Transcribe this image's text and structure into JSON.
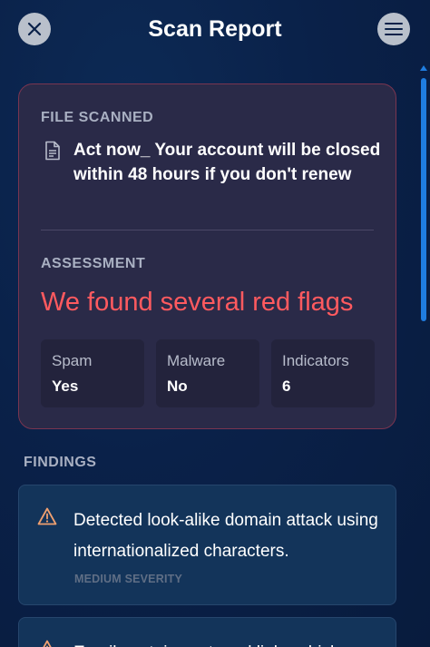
{
  "header": {
    "title": "Scan Report",
    "close_icon": "close-icon",
    "menu_icon": "menu-icon"
  },
  "report": {
    "file_section_label": "FILE SCANNED",
    "file_icon": "document-icon",
    "file_name": "Act now_ Your account will be closed within 48 hours if you don't renew",
    "assessment_label": "ASSESSMENT",
    "verdict": "We found several red flags",
    "verdict_color": "#ff5a5f",
    "stats": [
      {
        "label": "Spam",
        "value": "Yes"
      },
      {
        "label": "Malware",
        "value": "No"
      },
      {
        "label": "Indicators",
        "value": "6"
      }
    ]
  },
  "findings": {
    "label": "FINDINGS",
    "items": [
      {
        "icon": "warning-icon",
        "text": "Detected look-alike domain attack using internationalized characters.",
        "severity": "MEDIUM SEVERITY"
      },
      {
        "icon": "warning-icon",
        "text": "Email contains external links which",
        "severity": ""
      }
    ]
  },
  "colors": {
    "accent": "#1f7de0",
    "warning": "#f0a070",
    "card_border": "#7a3550"
  }
}
